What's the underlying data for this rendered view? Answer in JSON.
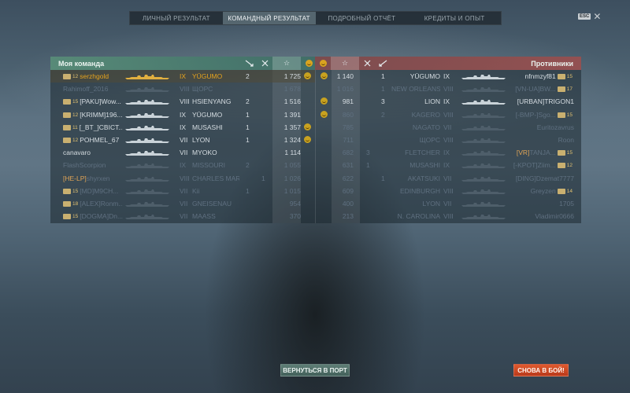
{
  "tabs": [
    {
      "label": "ЛИЧНЫЙ РЕЗУЛЬТАТ",
      "active": false
    },
    {
      "label": "КОМАНДНЫЙ РЕЗУЛЬТАТ",
      "active": true
    },
    {
      "label": "ПОДРОБНЫЙ ОТЧЁТ",
      "active": false
    },
    {
      "label": "КРЕДИТЫ И ОПЫТ",
      "active": false
    }
  ],
  "esc_label": "ESC",
  "my_team": {
    "title": "Моя команда",
    "rows": [
      {
        "rank": "12",
        "clan": "",
        "name": "serzhgold",
        "tier": "IX",
        "ship": "YŪGUMO",
        "kills": "2",
        "planes": "",
        "xp": "1 725",
        "emoji": true,
        "highlight": true,
        "dead": false
      },
      {
        "rank": "",
        "clan": "",
        "name": "Rahimoff_2016",
        "tier": "VIII",
        "ship": "ЩОРС",
        "kills": "",
        "planes": "",
        "xp": "1 678",
        "emoji": false,
        "highlight": false,
        "dead": true
      },
      {
        "rank": "15",
        "clan": "[PAKU]",
        "name": "Wow...",
        "tier": "VIII",
        "ship": "HSIENYANG",
        "kills": "2",
        "planes": "",
        "xp": "1 516",
        "emoji": false,
        "highlight": false,
        "dead": false
      },
      {
        "rank": "12",
        "clan": "[KRIMM]",
        "name": "196...",
        "tier": "IX",
        "ship": "YŪGUMO",
        "kills": "1",
        "planes": "",
        "xp": "1 391",
        "emoji": false,
        "highlight": false,
        "dead": false
      },
      {
        "rank": "11",
        "clan": "[_BT_]",
        "name": "CBICT...",
        "tier": "IX",
        "ship": "MUSASHI",
        "kills": "1",
        "planes": "",
        "xp": "1 357",
        "emoji": true,
        "highlight": false,
        "dead": false
      },
      {
        "rank": "12",
        "clan": "",
        "name": "POHMEL_67",
        "tier": "VII",
        "ship": "LYON",
        "kills": "1",
        "planes": "",
        "xp": "1 324",
        "emoji": true,
        "highlight": false,
        "dead": false
      },
      {
        "rank": "",
        "clan": "",
        "name": "canavaro",
        "tier": "VII",
        "ship": "MYOKO",
        "kills": "",
        "planes": "",
        "xp": "1 114",
        "emoji": false,
        "highlight": false,
        "dead": false
      },
      {
        "rank": "",
        "clan": "",
        "name": "FlashScorpion",
        "tier": "IX",
        "ship": "MISSOURI",
        "kills": "2",
        "planes": "",
        "xp": "1 055",
        "emoji": false,
        "highlight": false,
        "dead": true
      },
      {
        "rank": "",
        "clan": "[HE-LP]",
        "name": "shyrxen",
        "tier": "VIII",
        "ship": "CHARLES MAR...",
        "kills": "",
        "planes": "1",
        "xp": "1 026",
        "emoji": false,
        "highlight": false,
        "dead": true
      },
      {
        "rank": "15",
        "clan": "[MD]",
        "name": "M9CH...",
        "tier": "VII",
        "ship": "Kii",
        "kills": "1",
        "planes": "",
        "xp": "1 015",
        "emoji": false,
        "highlight": false,
        "dead": true
      },
      {
        "rank": "18",
        "clan": "[ALEX]",
        "name": "Ronm...",
        "tier": "VII",
        "ship": "GNEISENAU",
        "kills": "",
        "planes": "",
        "xp": "954",
        "emoji": false,
        "highlight": false,
        "dead": true
      },
      {
        "rank": "15",
        "clan": "[DOGMA]",
        "name": "Dn...",
        "tier": "VII",
        "ship": "MAASS",
        "kills": "",
        "planes": "",
        "xp": "370",
        "emoji": false,
        "highlight": false,
        "dead": true
      }
    ]
  },
  "enemy_team": {
    "title": "Противники",
    "rows": [
      {
        "emoji": true,
        "xp": "1 140",
        "planes": "",
        "kills": "1",
        "ship": "YŪGUMO",
        "tier": "IX",
        "clan": "",
        "name": "nfnmzyf81",
        "rank": "15",
        "dead": false
      },
      {
        "emoji": false,
        "xp": "1 016",
        "planes": "",
        "kills": "1",
        "ship": "NEW ORLEANS",
        "tier": "VIII",
        "clan": "[VN-UA]",
        "name": "BW...",
        "rank": "17",
        "dead": true
      },
      {
        "emoji": true,
        "xp": "981",
        "planes": "",
        "kills": "3",
        "ship": "LION",
        "tier": "IX",
        "clan": "[URBAN]",
        "name": "TRIGON1",
        "rank": "",
        "dead": false
      },
      {
        "emoji": true,
        "xp": "860",
        "planes": "",
        "kills": "2",
        "ship": "KAGERO",
        "tier": "VIII",
        "clan": "[-BMP-]",
        "name": "Sgo...",
        "rank": "15",
        "dead": true
      },
      {
        "emoji": false,
        "xp": "785",
        "planes": "",
        "kills": "",
        "ship": "NAGATO",
        "tier": "VII",
        "clan": "",
        "name": "Euritozavrus",
        "rank": "",
        "dead": true
      },
      {
        "emoji": false,
        "xp": "711",
        "planes": "",
        "kills": "",
        "ship": "ЩОРС",
        "tier": "VIII",
        "clan": "",
        "name": "Roon",
        "rank": "",
        "dead": true
      },
      {
        "emoji": false,
        "xp": "682",
        "planes": "3",
        "kills": "",
        "ship": "FLETCHER",
        "tier": "IX",
        "clan": "[VR]",
        "name": "TANJA...",
        "rank": "15",
        "dead": true
      },
      {
        "emoji": false,
        "xp": "631",
        "planes": "1",
        "kills": "",
        "ship": "MUSASHI",
        "tier": "IX",
        "clan": "[-KPOT]",
        "name": "Ziim...",
        "rank": "12",
        "dead": true
      },
      {
        "emoji": false,
        "xp": "622",
        "planes": "",
        "kills": "1",
        "ship": "AKATSUKI",
        "tier": "VII",
        "clan": "[DING]",
        "name": "Dzemat7777",
        "rank": "",
        "dead": true
      },
      {
        "emoji": false,
        "xp": "609",
        "planes": "",
        "kills": "",
        "ship": "EDINBURGH",
        "tier": "VIII",
        "clan": "",
        "name": "Greyzen",
        "rank": "14",
        "dead": true
      },
      {
        "emoji": false,
        "xp": "400",
        "planes": "",
        "kills": "",
        "ship": "LYON",
        "tier": "VII",
        "clan": "",
        "name": "1705",
        "rank": "",
        "dead": true
      },
      {
        "emoji": false,
        "xp": "213",
        "planes": "",
        "kills": "",
        "ship": "N. CAROLINA",
        "tier": "VIII",
        "clan": "",
        "name": "Vladimir0666",
        "rank": "",
        "dead": true
      }
    ]
  },
  "buttons": {
    "port": "ВЕРНУТЬСЯ В ПОРТ",
    "battle": "СНОВА В БОЙ!"
  },
  "colors": {
    "my_team_header": "#588c78",
    "enemy_header": "#964f50",
    "player_highlight": "#e6a31d",
    "battle_button": "#d24a25"
  },
  "icons": [
    "kills-icon",
    "planes-destroyed-icon",
    "xp-star-icon",
    "emoji-icon",
    "close-icon"
  ]
}
